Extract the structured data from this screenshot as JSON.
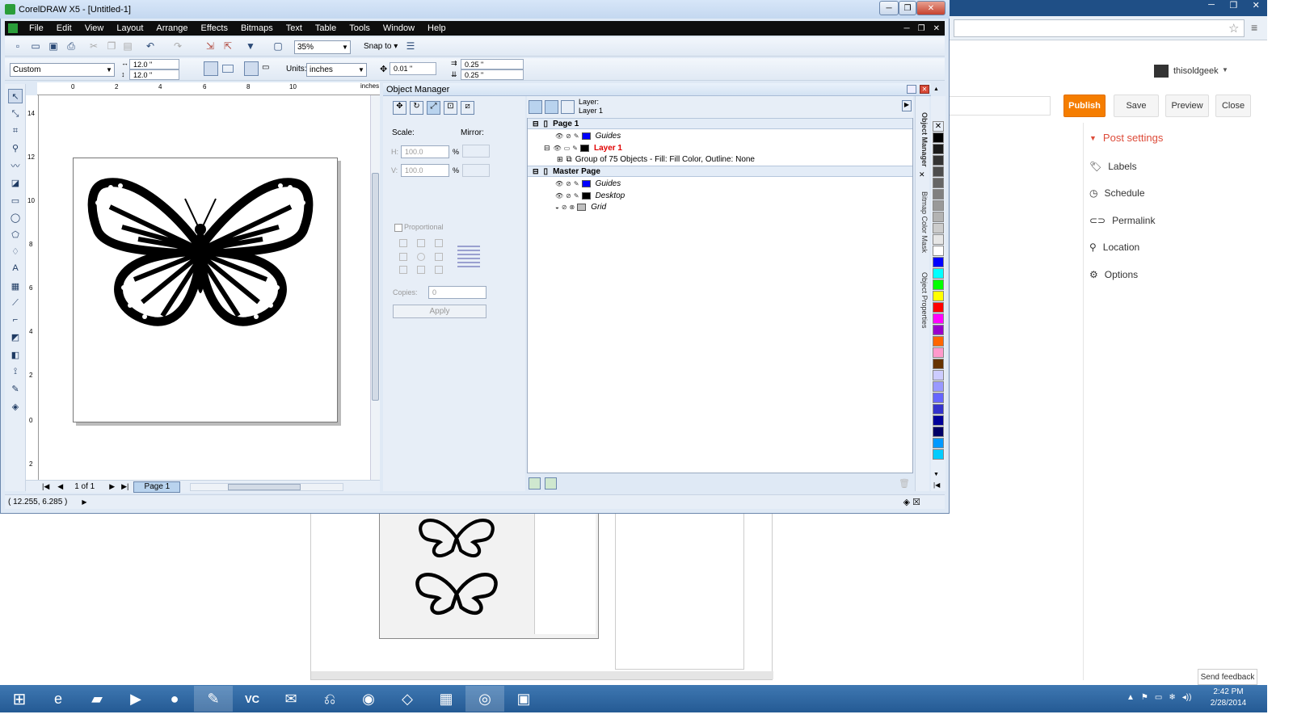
{
  "corel": {
    "title": "CorelDRAW X5 - [Untitled-1]",
    "menus": [
      "File",
      "Edit",
      "View",
      "Layout",
      "Arrange",
      "Effects",
      "Bitmaps",
      "Text",
      "Table",
      "Tools",
      "Window",
      "Help"
    ],
    "zoom": "35%",
    "snap_to": "Snap to",
    "page_size": "Custom",
    "page_width": "12.0 \"",
    "page_height": "12.0 \"",
    "units_label": "Units:",
    "units": "inches",
    "nudge": "0.01 \"",
    "dup_x": "0.25 \"",
    "dup_y": "0.25 \"",
    "ruler_unit": "inches",
    "hruler_ticks": [
      "0",
      "2",
      "4",
      "6",
      "8",
      "10"
    ],
    "vruler_ticks": [
      "14",
      "12",
      "10",
      "8",
      "6",
      "4",
      "2",
      "0",
      "2"
    ],
    "page_count": "1 of 1",
    "page_tab": "Page 1",
    "status_coords": "( 12.255, 6.285 )"
  },
  "object_manager": {
    "title": "Object Manager",
    "layer_label": "Layer:",
    "layer_value": "Layer 1",
    "scale_label": "Scale:",
    "mirror_label": "Mirror:",
    "h_label": "H:",
    "h_value": "100.0",
    "v_label": "V:",
    "v_value": "100.0",
    "pct": "%",
    "proportional": "Proportional",
    "copies_label": "Copies:",
    "copies_value": "0",
    "apply": "Apply",
    "tree": [
      {
        "type": "page",
        "label": "Page 1"
      },
      {
        "type": "layer",
        "label": "Guides",
        "color": "#0000ff",
        "italic": true
      },
      {
        "type": "layer",
        "label": "Layer 1",
        "color": "#000000",
        "red": true
      },
      {
        "type": "object",
        "label": "Group of 75 Objects - Fill: Fill Color, Outline: None"
      },
      {
        "type": "page",
        "label": "Master Page"
      },
      {
        "type": "layer",
        "label": "Guides",
        "color": "#0000ff",
        "italic": true
      },
      {
        "type": "layer",
        "label": "Desktop",
        "color": "#000000",
        "italic": true
      },
      {
        "type": "layer",
        "label": "Grid",
        "color": "#c0c0c0",
        "italic": true
      }
    ],
    "dock_tabs": [
      "Object Manager",
      "Bitmap Color Mask",
      "Object Properties"
    ]
  },
  "palette": [
    "#000000",
    "#1a1a1a",
    "#333333",
    "#4d4d4d",
    "#666666",
    "#808080",
    "#999999",
    "#b3b3b3",
    "#cccccc",
    "#e6e6e6",
    "#ffffff",
    "#0000ff",
    "#00ffff",
    "#00ff00",
    "#ffff00",
    "#ff0000",
    "#ff00ff",
    "#9900cc",
    "#ff6600",
    "#ff99cc",
    "#663300",
    "#ccccff",
    "#9999ff",
    "#6666ff",
    "#3333cc",
    "#000099",
    "#000066",
    "#0099ff",
    "#00ccff"
  ],
  "blogger": {
    "user": "thisoldgeek",
    "publish": "Publish",
    "save": "Save",
    "preview": "Preview",
    "close": "Close",
    "post_settings": "Post settings",
    "settings": [
      "Labels",
      "Schedule",
      "Permalink",
      "Location",
      "Options"
    ],
    "send_feedback": "Send feedback"
  },
  "taskbar": {
    "time": "2:42 PM",
    "date": "2/28/2014"
  }
}
